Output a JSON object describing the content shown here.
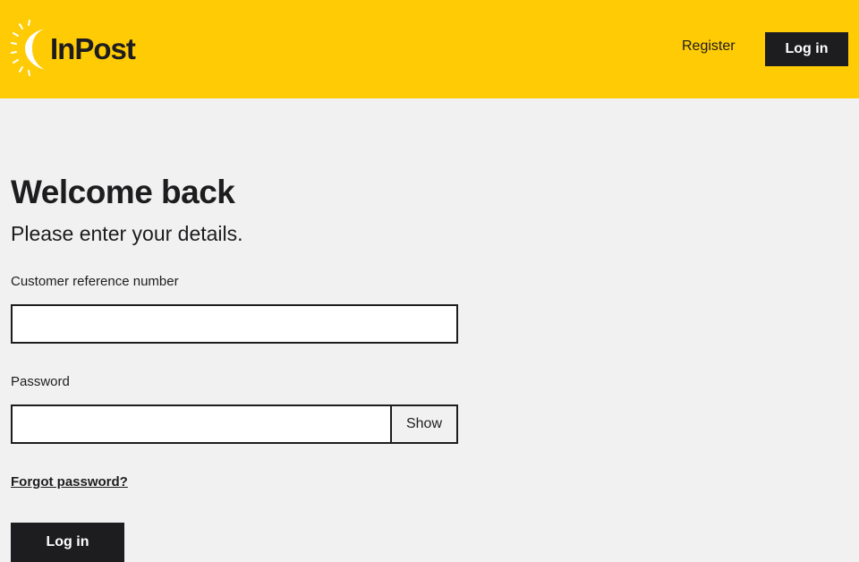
{
  "header": {
    "logo_text": "InPost",
    "register_label": "Register",
    "login_label": "Log in",
    "brand_color": "#ffcb05"
  },
  "form": {
    "title": "Welcome back",
    "subtitle": "Please enter your details.",
    "customer_ref_label": "Customer reference number",
    "customer_ref_value": "",
    "password_label": "Password",
    "password_value": "",
    "show_label": "Show",
    "forgot_label": "Forgot password?",
    "submit_label": "Log in"
  },
  "icons": {
    "logo": "inpost-sun-logo-icon"
  }
}
